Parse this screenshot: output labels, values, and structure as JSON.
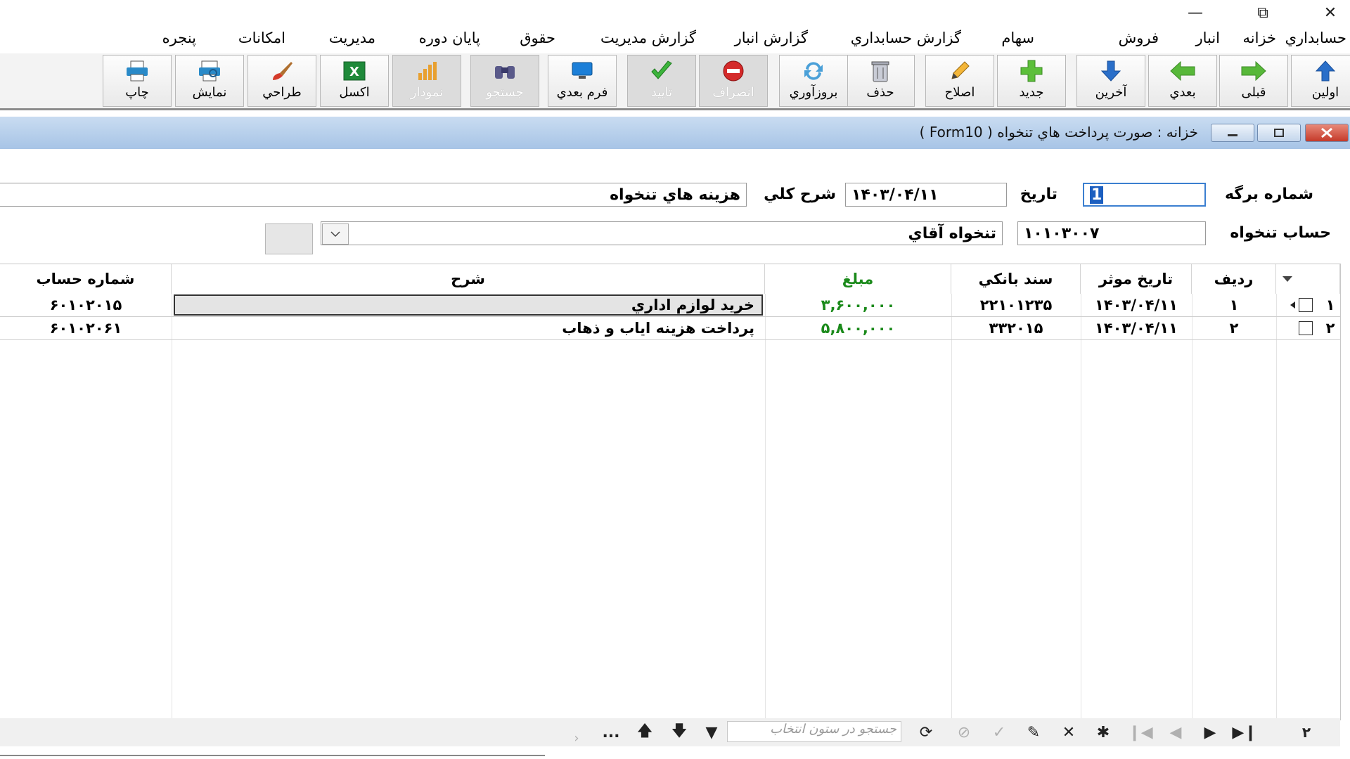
{
  "window": {
    "minimize_icon": "minimize-icon",
    "restore_icon": "restore-icon",
    "close_icon": "close-icon"
  },
  "menu": [
    "حسابداري",
    "خزانه",
    "انبار",
    "فروش",
    "سهام",
    "گزارش حسابداري",
    "گزارش انبار",
    "گزارش مديريت",
    "حقوق",
    "پايان دوره",
    "مديريت",
    "امكانات",
    "پنجره"
  ],
  "toolbar": {
    "first": "اولين",
    "prev": "قبلی",
    "next": "بعدي",
    "last": "آخرين",
    "new": "جديد",
    "edit": "اصلاح",
    "delete": "حذف",
    "refresh": "بروزآوري",
    "cancel": "انصراف",
    "confirm": "تاييد",
    "next_form": "فرم بعدي",
    "search": "جستجو",
    "chart": "نمودار",
    "excel": "اكسل",
    "design": "طراحي",
    "preview": "نمايش",
    "print": "چاپ"
  },
  "form_window": {
    "title": "خزانه : صورت پرداخت هاي تنخواه ( Form10 )"
  },
  "form": {
    "sheet_number_label": "شماره برگه",
    "sheet_number_value": "1",
    "date_label": "تاريخ",
    "date_value": "۱۴۰۳/۰۴/۱۱",
    "description_label": "شرح كلي",
    "description_value": "هزينه هاي تنخواه",
    "petty_account_label": "حساب تنخواه",
    "petty_account_code": "۱۰۱۰۳۰۰۷",
    "petty_account_name": "تنخواه آقاي"
  },
  "grid": {
    "headers": {
      "row": "رديف",
      "effective_date": "تاريخ موثر",
      "bank_doc": "سند بانكي",
      "amount": "مبلغ",
      "description": "شرح",
      "account_number": "شماره حساب"
    },
    "rows": [
      {
        "index": "۱",
        "row": "۱",
        "date": "۱۴۰۳/۰۴/۱۱",
        "bank_doc": "۲۲۱۰۱۲۳۵",
        "amount": "۳,۶۰۰,۰۰۰",
        "description": "خريد لوازم اداري",
        "account": "۶۰۱۰۲۰۱۵"
      },
      {
        "index": "۲",
        "row": "۲",
        "date": "۱۴۰۳/۰۴/۱۱",
        "bank_doc": "۳۳۲۰۱۵",
        "amount": "۵,۸۰۰,۰۰۰",
        "description": "پرداخت هزينه اياب و ذهاب",
        "account": "۶۰۱۰۲۰۶۱"
      }
    ]
  },
  "navigator": {
    "record_count": "۲",
    "search_placeholder": "جستجو در ستون انتخاب",
    "more": "..."
  },
  "colors": {
    "titlebar": "#a7c4e6",
    "amount_green": "#1b8a1b"
  }
}
